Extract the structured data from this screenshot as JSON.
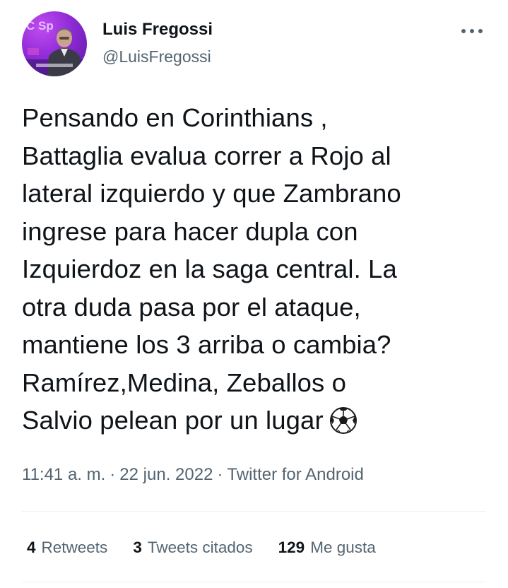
{
  "author": {
    "name": "Luis Fregossi",
    "handle": "@LuisFregossi",
    "avatar_icon": "profile-photo",
    "avatar_brand_color": "#8e2bd6"
  },
  "menu": {
    "icon": "more-options-icon"
  },
  "tweet": {
    "lines": [
      "Pensando en Corinthians ,",
      "Battaglia evalua correr a Rojo al",
      "lateral izquierdo y que Zambrano",
      "ingrese para hacer dupla con",
      "Izquierdoz en la saga central. La",
      "otra duda pasa por el ataque,",
      "mantiene los 3 arriba o cambia?",
      "Ramírez,Medina, Zeballos o",
      "Salvio pelean por un lugar"
    ],
    "emoji": "soccer-ball-icon"
  },
  "meta": {
    "time": "11:41 a. m.",
    "separator": "·",
    "date": "22 jun. 2022",
    "source": "Twitter for Android"
  },
  "stats": {
    "retweets_count": "4",
    "retweets_label": "Retweets",
    "quotes_count": "3",
    "quotes_label": "Tweets citados",
    "likes_count": "129",
    "likes_label": "Me gusta"
  },
  "colors": {
    "text_primary": "#0f1419",
    "text_secondary": "#536471",
    "divider": "#eff3f4"
  }
}
